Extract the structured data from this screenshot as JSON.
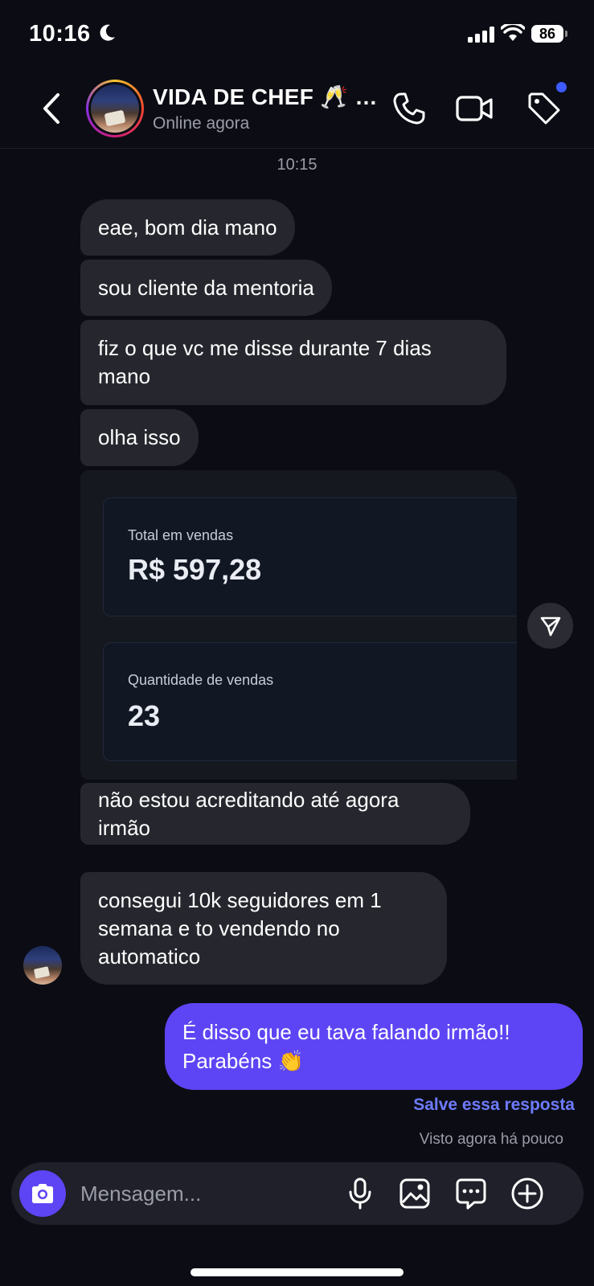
{
  "status_bar": {
    "time": "10:16",
    "battery": "86"
  },
  "header": {
    "name": "VIDA DE CHEF 🥂 …",
    "status": "Online agora",
    "icons": [
      "back-icon",
      "phone-icon",
      "video-icon",
      "tag-icon"
    ]
  },
  "timestamp": "10:15",
  "messages": {
    "m1": "eae, bom dia mano",
    "m2": "sou cliente da mentoria",
    "m3": "fiz o que vc me disse durante 7 dias mano",
    "m4": "olha isso",
    "card_total_label": "Total em vendas",
    "card_total_value": "R$ 597,28",
    "card_qty_label": "Quantidade de vendas",
    "card_qty_value": "23",
    "m6": "não estou acreditando até agora irmão",
    "m7": "consegui 10k seguidores em 1 semana e to vendendo no automatico",
    "mine": "É disso que eu tava falando irmão!! Parabéns 👏"
  },
  "save_reply": "Salve essa resposta",
  "seen": "Visto agora há pouco",
  "composer": {
    "placeholder": "Mensagem..."
  },
  "colors": {
    "accent": "#5d45f5",
    "bubble": "#26272e",
    "background": "#0c0d14",
    "link": "#6e7bff"
  }
}
